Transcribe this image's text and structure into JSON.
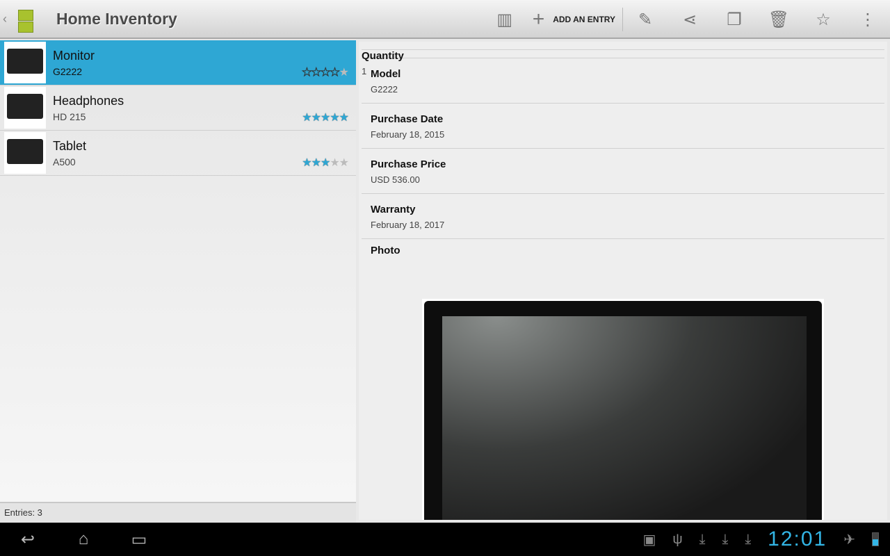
{
  "header": {
    "title": "Home Inventory",
    "add_label": "ADD AN ENTRY"
  },
  "icons": [
    "barcode-search-icon",
    "add-icon",
    "edit-icon",
    "share-icon",
    "copy-icon",
    "delete-icon",
    "favorite-icon",
    "overflow-icon"
  ],
  "items": [
    {
      "name": "Monitor",
      "model": "G2222",
      "rating": 4,
      "selected": true
    },
    {
      "name": "Headphones",
      "model": "HD 215",
      "rating": 5,
      "selected": false
    },
    {
      "name": "Tablet",
      "model": "A500",
      "rating": 3,
      "selected": false
    }
  ],
  "footer": {
    "entries": "Entries: 3"
  },
  "detail": {
    "fields": [
      {
        "label": "Quantity",
        "value": "1"
      },
      {
        "label": "Model",
        "value": "G2222"
      },
      {
        "label": "Purchase Date",
        "value": "February 18, 2015"
      },
      {
        "label": "Purchase Price",
        "value": "USD 536.00"
      },
      {
        "label": "Warranty",
        "value": "February 18, 2017"
      }
    ],
    "photo_label": "Photo"
  },
  "status": {
    "time": "12:01"
  },
  "colors": {
    "accent": "#2ea7d4",
    "clock": "#33b5e5"
  }
}
